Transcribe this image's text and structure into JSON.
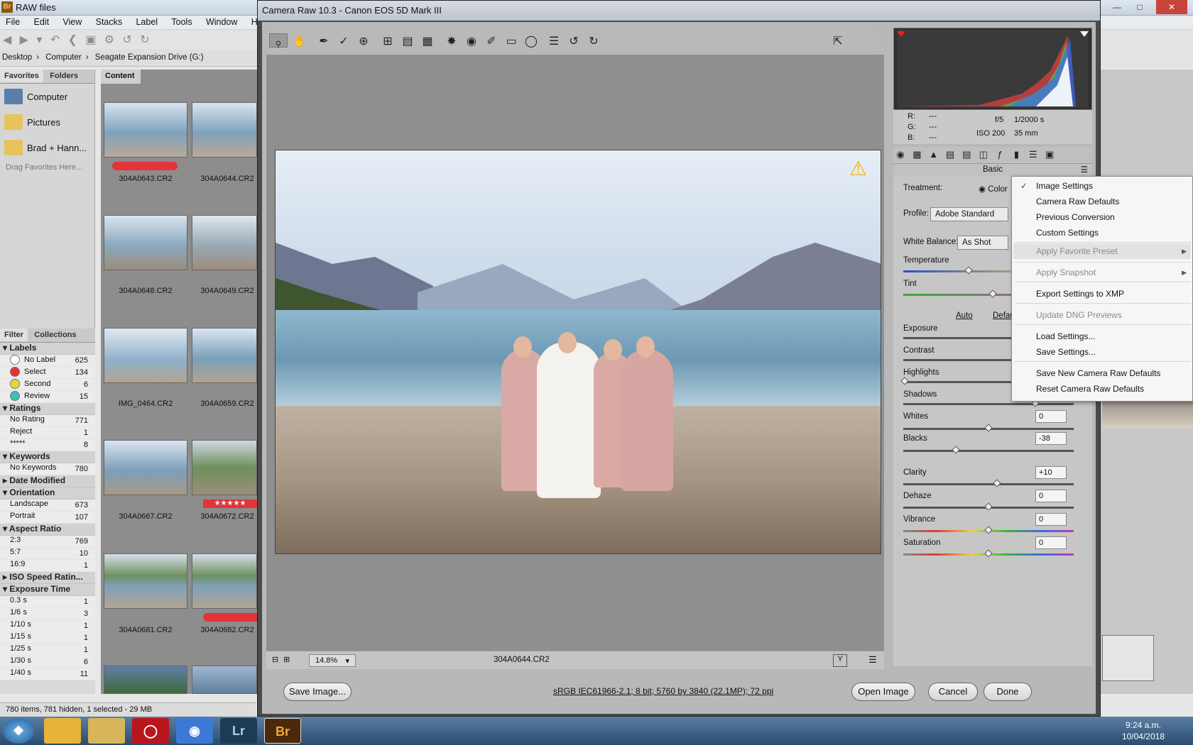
{
  "bridge": {
    "title": "RAW files",
    "menu": [
      "File",
      "Edit",
      "View",
      "Stacks",
      "Label",
      "Tools",
      "Window",
      "Help"
    ],
    "path": [
      "Desktop",
      "Computer",
      "Seagate Expansion Drive (G:)"
    ],
    "tabs": {
      "favorites": "Favorites",
      "folders": "Folders",
      "content": "Content",
      "filter": "Filter",
      "collections": "Collections"
    },
    "favorites": [
      "Computer",
      "Pictures",
      "Brad + Hann..."
    ],
    "favorites_hint": "Drag Favorites Here...",
    "filter": {
      "labels": {
        "title": "Labels",
        "items": [
          [
            "No Label",
            "625"
          ],
          [
            "Select",
            "134"
          ],
          [
            "Second",
            "6"
          ],
          [
            "Review",
            "15"
          ]
        ]
      },
      "ratings": {
        "title": "Ratings",
        "items": [
          [
            "No Rating",
            "771"
          ],
          [
            "Reject",
            "1"
          ],
          [
            "*****",
            "8"
          ]
        ]
      },
      "keywords": {
        "title": "Keywords",
        "items": [
          [
            "No Keywords",
            "780"
          ]
        ]
      },
      "date_modified": "Date Modified",
      "orientation": {
        "title": "Orientation",
        "items": [
          [
            "Landscape",
            "673"
          ],
          [
            "Portrait",
            "107"
          ]
        ]
      },
      "aspect": {
        "title": "Aspect Ratio",
        "items": [
          [
            "2:3",
            "769"
          ],
          [
            "5:7",
            "10"
          ],
          [
            "16:9",
            "1"
          ]
        ]
      },
      "iso": "ISO Speed Ratin...",
      "exposure": {
        "title": "Exposure Time",
        "items": [
          [
            "0.3 s",
            "1"
          ],
          [
            "1/6 s",
            "3"
          ],
          [
            "1/10 s",
            "1"
          ],
          [
            "1/15 s",
            "1"
          ],
          [
            "1/25 s",
            "1"
          ],
          [
            "1/30 s",
            "6"
          ],
          [
            "1/40 s",
            "11"
          ]
        ]
      }
    },
    "thumbnails": [
      "304A0643.CR2",
      "304A0644.CR2",
      "304A0648.CR2",
      "304A0649.CR2",
      "IMG_0464.CR2",
      "304A0659.CR2",
      "304A0667.CR2",
      "304A0672.CR2",
      "304A0681.CR2",
      "304A0682.CR2"
    ],
    "status": "780 items, 781 hidden, 1 selected - 29 MB"
  },
  "acr": {
    "title": "Camera Raw 10.3  -  Canon EOS 5D Mark III",
    "zoom": "14.8%",
    "filename": "304A0644.CR2",
    "workflow": "sRGB IEC61966-2.1; 8 bit; 5760 by 3840 (22.1MP); 72 ppi",
    "buttons": {
      "save": "Save Image...",
      "open": "Open Image",
      "cancel": "Cancel",
      "done": "Done"
    },
    "rgb": {
      "r": "R:",
      "g": "G:",
      "b": "B:",
      "dash": "---"
    },
    "exif": {
      "aperture": "f/5",
      "shutter": "1/2000 s",
      "iso": "ISO 200",
      "focal": "35 mm"
    },
    "panel_title": "Basic",
    "treatment_label": "Treatment:",
    "treatment_value": "Color",
    "profile_label": "Profile:",
    "profile_value": "Adobe Standard",
    "wb_label": "White Balance:",
    "wb_value": "As Shot",
    "temperature": "Temperature",
    "tint": "Tint",
    "auto": "Auto",
    "default": "Defau",
    "sliders": {
      "exposure": "Exposure",
      "contrast": "Contrast",
      "highlights": "Highlights",
      "shadows": "Shadows",
      "whites": "Whites",
      "whites_v": "0",
      "blacks": "Blacks",
      "blacks_v": "-38",
      "clarity": "Clarity",
      "clarity_v": "+10",
      "dehaze": "Dehaze",
      "dehaze_v": "0",
      "vibrance": "Vibrance",
      "vibrance_v": "0",
      "saturation": "Saturation",
      "saturation_v": "0"
    },
    "menu": {
      "check": "✓",
      "image_settings": "Image Settings",
      "camera_raw_defaults": "Camera Raw Defaults",
      "previous_conversion": "Previous Conversion",
      "custom_settings": "Custom Settings",
      "apply_favorite_preset": "Apply Favorite Preset",
      "apply_snapshot": "Apply Snapshot",
      "export_xmp": "Export Settings to XMP",
      "update_dng": "Update DNG Previews",
      "load_settings": "Load Settings...",
      "save_settings": "Save Settings...",
      "save_new_defaults": "Save New Camera Raw Defaults",
      "reset_defaults": "Reset Camera Raw Defaults"
    }
  },
  "taskbar": {
    "lr": "Lr",
    "br": "Br",
    "time": "9:24 a.m.",
    "date": "10/04/2018"
  }
}
